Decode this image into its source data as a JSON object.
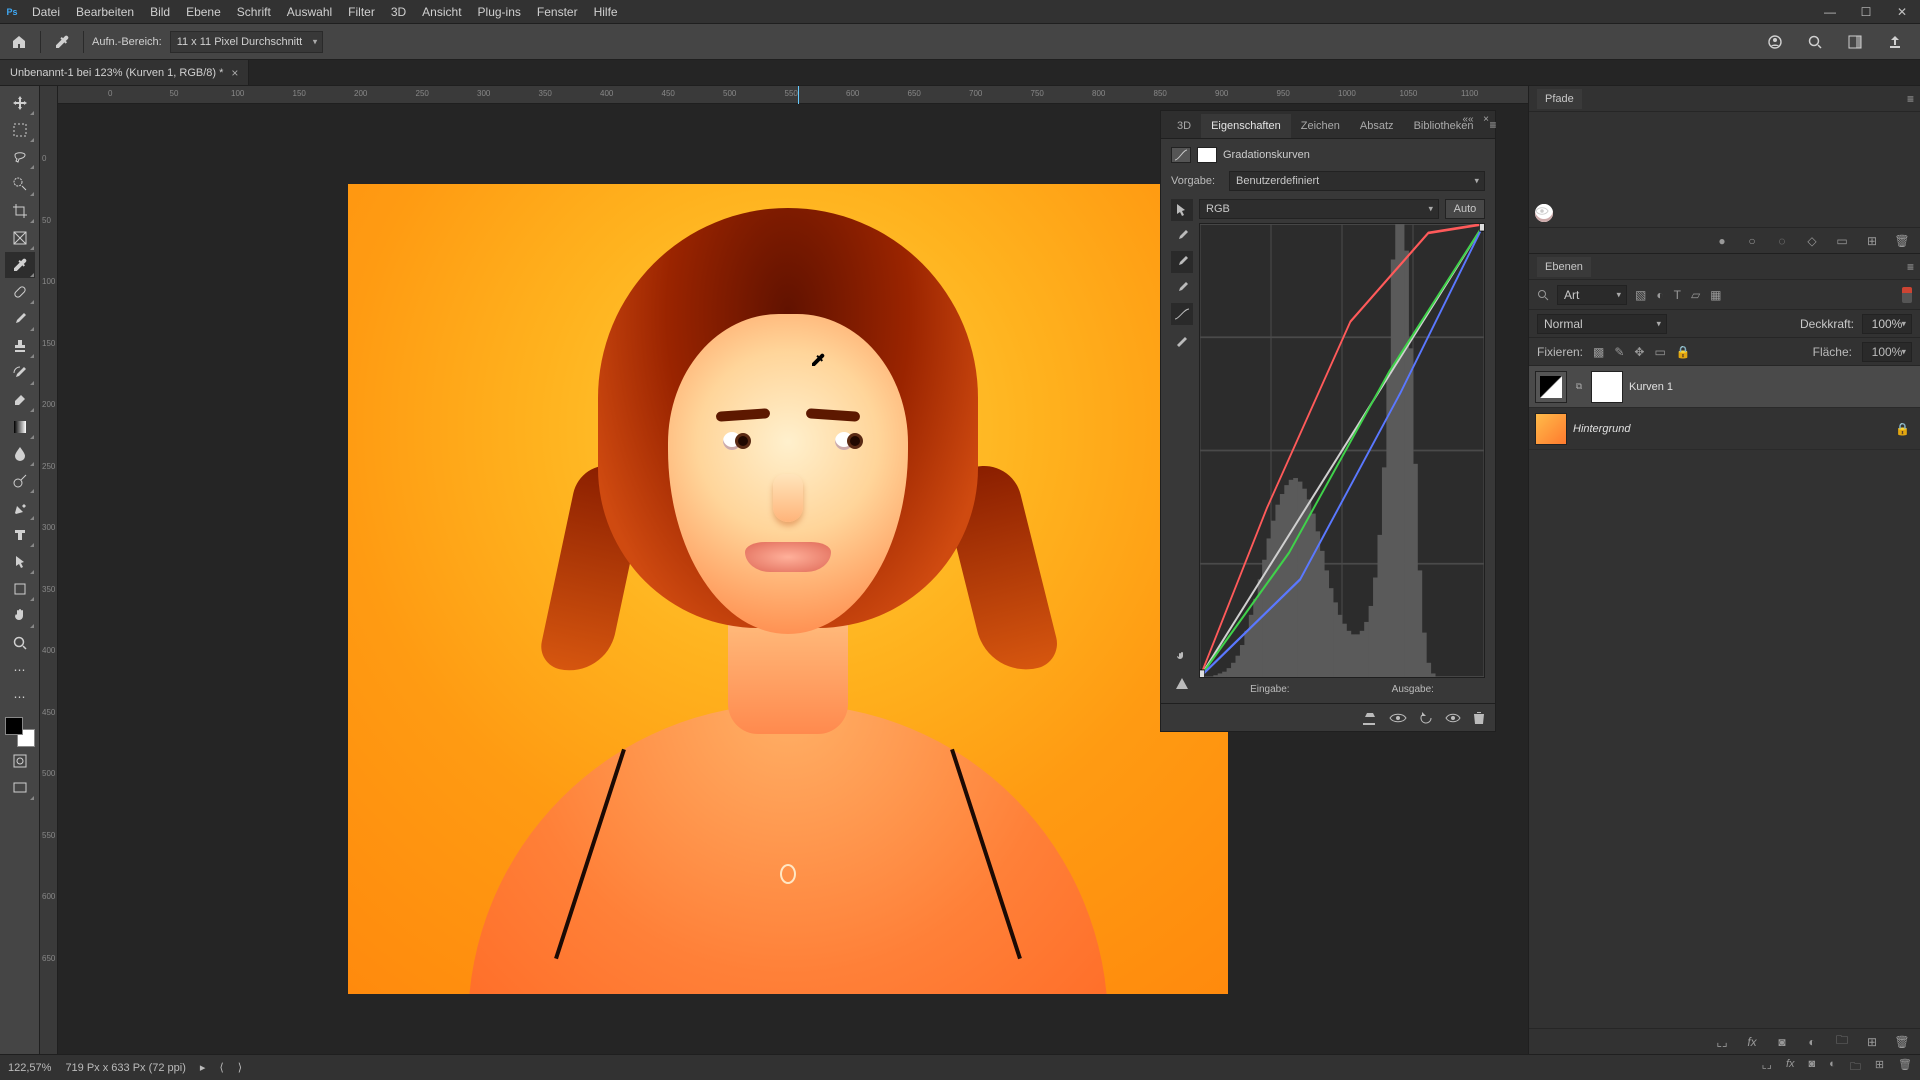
{
  "menu": [
    "Datei",
    "Bearbeiten",
    "Bild",
    "Ebene",
    "Schrift",
    "Auswahl",
    "Filter",
    "3D",
    "Ansicht",
    "Plug-ins",
    "Fenster",
    "Hilfe"
  ],
  "options": {
    "sample_label": "Aufn.-Bereich:",
    "sample_value": "11 x 11 Pixel Durchschnitt"
  },
  "tab": {
    "title": "Unbenannt-1 bei 123% (Kurven 1, RGB/8) *"
  },
  "ruler_marks": [
    0,
    50,
    100,
    150,
    200,
    250,
    300,
    350,
    400,
    450,
    500,
    550,
    600,
    650,
    700,
    750,
    800,
    850,
    900,
    950,
    1000,
    1050,
    1100
  ],
  "panels": {
    "pfade": "Pfade",
    "ebenen": "Ebenen",
    "props_tabs": [
      "3D",
      "Eigenschaften",
      "Zeichen",
      "Absatz",
      "Bibliotheken"
    ]
  },
  "properties": {
    "adj_type": "Gradationskurven",
    "preset_label": "Vorgabe:",
    "preset_value": "Benutzerdefiniert",
    "channel_value": "RGB",
    "auto_label": "Auto",
    "input_label": "Eingabe:",
    "output_label": "Ausgabe:"
  },
  "layers": {
    "filter_mode": "Art",
    "blend_mode": "Normal",
    "opacity_label": "Deckkraft:",
    "opacity_value": "100%",
    "lock_label": "Fixieren:",
    "fill_label": "Fläche:",
    "fill_value": "100%",
    "items": [
      {
        "name": "Kurven 1",
        "kind": "adj",
        "selected": true
      },
      {
        "name": "Hintergrund",
        "kind": "bg",
        "selected": false
      }
    ]
  },
  "status": {
    "zoom": "122,57%",
    "doc": "719 Px x 633 Px (72 ppi)"
  },
  "chart_data": {
    "type": "line",
    "title": "Gradationskurven",
    "xlabel": "Eingabe",
    "ylabel": "Ausgabe",
    "xlim": [
      0,
      255
    ],
    "ylim": [
      0,
      255
    ],
    "series": [
      {
        "name": "RGB",
        "color": "#d0d0d0",
        "points": [
          [
            0,
            0
          ],
          [
            255,
            255
          ]
        ]
      },
      {
        "name": "Rot",
        "color": "#ff5a5a",
        "points": [
          [
            0,
            0
          ],
          [
            60,
            95
          ],
          [
            135,
            200
          ],
          [
            205,
            250
          ],
          [
            255,
            255
          ]
        ]
      },
      {
        "name": "Grün",
        "color": "#3fd24a",
        "points": [
          [
            0,
            0
          ],
          [
            80,
            70
          ],
          [
            170,
            172
          ],
          [
            255,
            255
          ]
        ]
      },
      {
        "name": "Blau",
        "color": "#5a78ff",
        "points": [
          [
            0,
            0
          ],
          [
            90,
            55
          ],
          [
            180,
            160
          ],
          [
            255,
            255
          ]
        ]
      }
    ],
    "histogram": [
      0,
      0,
      0,
      1,
      2,
      3,
      5,
      8,
      12,
      18,
      26,
      35,
      44,
      55,
      66,
      78,
      88,
      97,
      103,
      108,
      111,
      112,
      110,
      106,
      100,
      92,
      82,
      71,
      60,
      50,
      42,
      35,
      30,
      26,
      24,
      24,
      26,
      31,
      40,
      56,
      80,
      118,
      170,
      235,
      255,
      255,
      240,
      185,
      120,
      60,
      25,
      8,
      2,
      0,
      0,
      0,
      0,
      0,
      0,
      0,
      0,
      0,
      0,
      0
    ]
  }
}
